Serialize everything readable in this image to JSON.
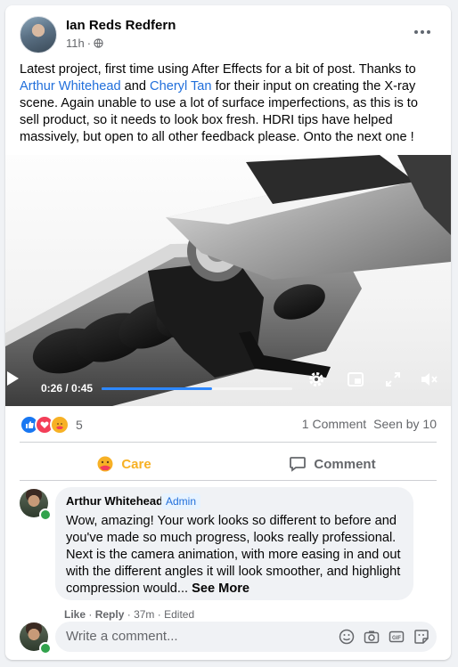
{
  "post": {
    "author": "Ian Reds Redfern",
    "time": "11h",
    "time_sep": "·",
    "text": {
      "part1": "Latest project, first time using After Effects for a bit of post. Thanks to ",
      "mention1": "Arthur Whitehead",
      "part2": " and ",
      "mention2": "Cheryl Tan",
      "part3": " for their input on creating the X-ray scene. Again unable to use a lot of surface imperfections, as this is to sell product, so it needs to look box fresh. HDRI tips have helped massively, but open to all other feedback please. Onto the next one !"
    }
  },
  "video": {
    "time": "0:26 / 0:45",
    "progress": 0.58
  },
  "stats": {
    "reaction_count": "5",
    "comments": "1 Comment",
    "seen": "Seen by 10"
  },
  "actions": {
    "care": "Care",
    "comment": "Comment"
  },
  "comment": {
    "author": "Arthur Whitehead",
    "badge": "Admin",
    "text": "Wow, amazing! Your work looks so different to before and you've made so much progress, looks really professional. Next is the camera animation, with more easing in and out with the different angles it will look smoother, and highlight compression would...",
    "see_more": "See More",
    "like": "Like",
    "reply": "Reply",
    "age": "37m",
    "edited": "Edited",
    "sep": "·"
  },
  "write": {
    "placeholder": "Write a comment..."
  },
  "colors": {
    "accent": "#216fdb",
    "care": "#f7b125",
    "progress": "#2d88ff",
    "online": "#31a24c"
  },
  "icons": [
    "globe-icon",
    "more-icon",
    "play-icon",
    "settings-icon",
    "miniplayer-icon",
    "fullscreen-icon",
    "volume-icon",
    "like-reaction-icon",
    "love-reaction-icon",
    "care-reaction-icon",
    "comment-icon",
    "emoji-icon",
    "camera-icon",
    "gif-icon",
    "sticker-icon"
  ]
}
